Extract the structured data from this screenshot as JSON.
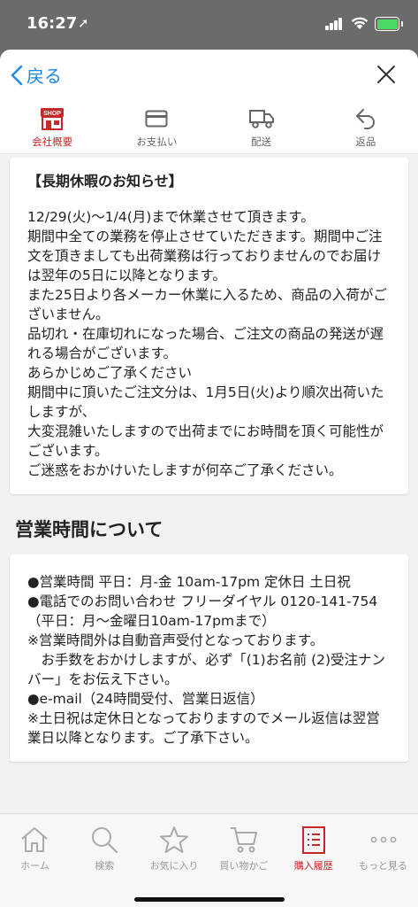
{
  "status": {
    "time": "16:27",
    "location_glyph": "➚"
  },
  "header": {
    "back_label": "戻る",
    "close": "close-icon"
  },
  "tabs": [
    {
      "label": "会社概要",
      "icon": "shop-icon",
      "active": true,
      "shop_badge": "SHOP"
    },
    {
      "label": "お支払い",
      "icon": "card-icon",
      "active": false
    },
    {
      "label": "配送",
      "icon": "truck-icon",
      "active": false
    },
    {
      "label": "返品",
      "icon": "return-icon",
      "active": false
    }
  ],
  "notice": {
    "title": "【長期休暇のお知らせ】",
    "lines": [
      "12/29(火)～1/4(月)まで休業させて頂きます。",
      "期間中全ての業務を停止させていただきます。期間中ご注文を頂きましても出荷業務は行っておりませんのでお届けは翌年の5日に以降となります。",
      "また25日より各メーカー休業に入るため、商品の入荷がございません。",
      "品切れ・在庫切れになった場合、ご注文の商品の発送が遅れる場合がございます。",
      "あらかじめご了承ください",
      "期間中に頂いたご注文分は、1月5日(火)より順次出荷いたしますが、",
      "大変混雑いたしますので出荷までにお時間を頂く可能性がございます。",
      "ご迷惑をおかけいたしますが何卒ご了承ください。"
    ]
  },
  "hours": {
    "title": "営業時間について",
    "lines": [
      "●営業時間 平日：月-金 10am-17pm 定休日 土日祝",
      "●電話でのお問い合わせ フリーダイヤル 0120-141-754（平日：月～金曜日10am-17pmまで）",
      "※営業時間外は自動音声受付となっております。",
      "　お手数をおかけしますが、必ず「(1)お名前 (2)受注ナンバー」をお伝え下さい。",
      "●e-mail（24時間受付、営業日返信）",
      "※土日祝は定休日となっておりますのでメール返信は翌営業日以降となります。ご了承下さい。"
    ]
  },
  "bottom_nav": [
    {
      "label": "ホーム",
      "icon": "home-icon",
      "active": false
    },
    {
      "label": "検索",
      "icon": "search-icon",
      "active": false
    },
    {
      "label": "お気に入り",
      "icon": "star-icon",
      "active": false
    },
    {
      "label": "買い物かご",
      "icon": "cart-icon",
      "active": false
    },
    {
      "label": "購入履歴",
      "icon": "history-icon",
      "active": true
    },
    {
      "label": "もっと見る",
      "icon": "more-icon",
      "active": false
    }
  ],
  "colors": {
    "accent_red": "#c62828",
    "link_blue": "#1e88e5",
    "battery_green": "#4cd964"
  }
}
